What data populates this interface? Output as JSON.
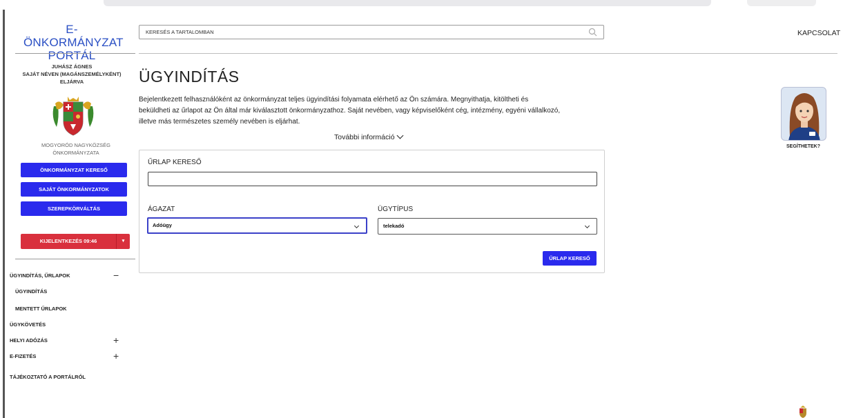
{
  "portal": {
    "logo_line1": "E-ÖNKORMÁNYZAT",
    "logo_line2": "PORTÁL"
  },
  "header": {
    "search_placeholder": "KERESÉS A TARTALOMBAN",
    "contact": "KAPCSOLAT"
  },
  "user": {
    "name": "JUHÁSZ ÁGNES",
    "role_line1": "SAJÁT NÉVEN (MAGÁNSZEMÉLYKÉNT)",
    "role_line2": "ELJÁRVA"
  },
  "municipality": {
    "line1": "MOGYORÓD NAGYKÖZSÉG",
    "line2": "ÖNKORMÁNYZATA"
  },
  "sidebar": {
    "buttons": [
      "ÖNKORMÁNYZAT KERESŐ",
      "SAJÁT ÖNKORMÁNYZATOK",
      "SZEREPKÖRVÁLTÁS"
    ],
    "logout": "KIJELENTKEZÉS 09:46",
    "nav": [
      {
        "label": "ÜGYINDÍTÁS, ŰRLAPOK",
        "toggle": "−"
      },
      {
        "label": "ÜGYINDÍTÁS"
      },
      {
        "label": "MENTETT ŰRLAPOK"
      },
      {
        "label": "ÜGYKÖVETÉS"
      },
      {
        "label": "HELYI ADÓZÁS",
        "toggle": "+"
      },
      {
        "label": "E-FIZETÉS",
        "toggle": "+"
      },
      {
        "label": "TÁJÉKOZTATÓ A PORTÁLRÓL"
      }
    ]
  },
  "main": {
    "title": "ÜGYINDÍTÁS",
    "intro_line1": "Bejelentkezett felhasználóként az önkormányzat teljes ügyindítási folyamata elérhető az Ön számára. Megnyithatja, kitöltheti és",
    "intro_line2": "beküldheti az űrlapot az Ön által már kiválasztott önkormányzathoz. Saját nevében, vagy képviselőként cég, intézmény, egyéni vállalkozó,",
    "intro_line3": "illetve más természetes személy nevében is eljárhat.",
    "more_info": "További információ"
  },
  "form": {
    "search_label": "ŰRLAP KERESŐ",
    "search_value": "",
    "sector_label": "ÁGAZAT",
    "sector_value": "Adóügy",
    "type_label": "ÜGYTÍPUS",
    "type_value": "telekadó",
    "submit_label": "ŰRLAP KERESŐ"
  },
  "assistant": {
    "label": "SEGÍTHETEK?"
  },
  "colors": {
    "accent": "#2a2aed",
    "logout": "#d9303d",
    "logo": "#2a4fc4"
  }
}
